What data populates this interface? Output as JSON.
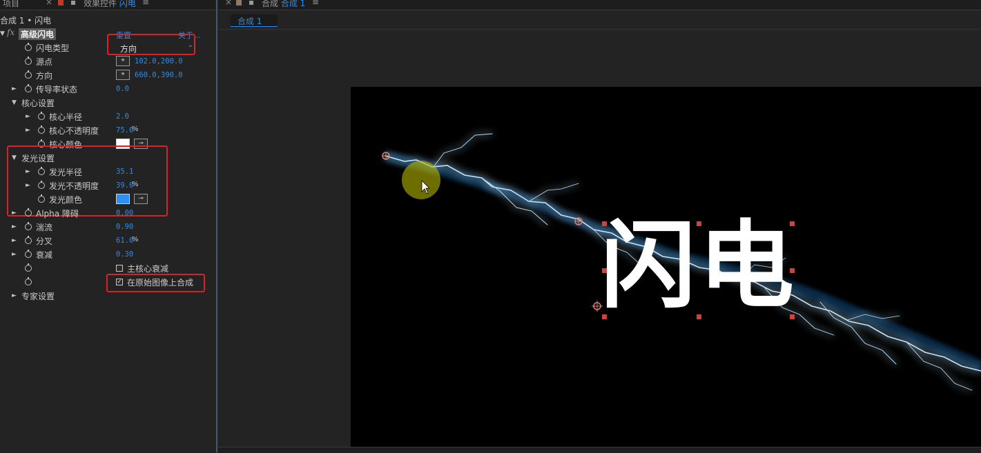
{
  "left_panel": {
    "tab_project": "项目",
    "tab_effects_prefix": "效果控件",
    "tab_effects_layer": "闪电",
    "breadcrumb": "合成 1 • 闪电",
    "fx_label": "fx",
    "effect_name": "高级闪电",
    "reset": "重置",
    "about": "关于...",
    "params": {
      "type_label": "闪电类型",
      "type_value": "方向",
      "origin_label": "源点",
      "origin_value": "102.0,200.0",
      "direction_label": "方向",
      "direction_value": "660.0,390.0",
      "conductivity_label": "传导率状态",
      "conductivity_value": "0.0",
      "core_group": "核心设置",
      "core_radius_label": "核心半径",
      "core_radius_value": "2.0",
      "core_opacity_label": "核心不透明度",
      "core_opacity_value": "75.0",
      "core_color_label": "核心颜色",
      "glow_group": "发光设置",
      "glow_radius_label": "发光半径",
      "glow_radius_value": "35.1",
      "glow_opacity_label": "发光不透明度",
      "glow_opacity_value": "39.0",
      "glow_color_label": "发光颜色",
      "alpha_label": "Alpha 障碍",
      "alpha_value": "0.00",
      "turbulence_label": "湍流",
      "turbulence_value": "0.90",
      "forking_label": "分叉",
      "forking_value": "61.0",
      "decay_label": "衰减",
      "decay_value": "0.30",
      "main_core_decay_label": "主核心衰减",
      "composite_label": "在原始图像上合成",
      "expert_group": "专家设置",
      "percent": "%"
    },
    "colors": {
      "core": "#ffffff",
      "glow": "#2d8ff0"
    }
  },
  "right_panel": {
    "tab_prefix": "合成",
    "tab_comp": "合成 1",
    "subtab": "合成 1",
    "canvas_text": "闪电"
  }
}
